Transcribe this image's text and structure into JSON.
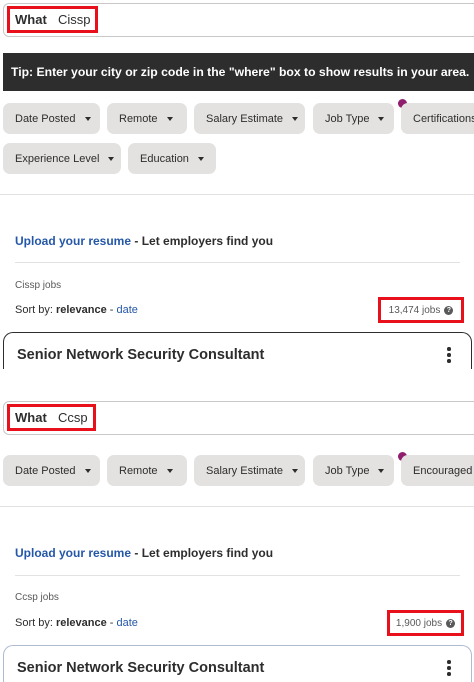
{
  "panel1": {
    "search": {
      "label": "What",
      "value": "Cissp"
    },
    "tip": "Tip: Enter your city or zip code in the \"where\" box to show results in your area.",
    "filters_row1": [
      "Date Posted",
      "Remote",
      "Salary Estimate",
      "Job Type",
      "Certifications"
    ],
    "filters_row2": [
      "Experience Level",
      "Education"
    ],
    "resume": {
      "link": "Upload your resume",
      "rest": " - Let employers find you"
    },
    "query_label": "Cissp jobs",
    "sort": {
      "prefix": "Sort by: ",
      "active": "relevance",
      "sep": " - ",
      "alt": "date"
    },
    "job_count": "13,474 jobs",
    "job_title": "Senior Network Security Consultant"
  },
  "panel2": {
    "search": {
      "label": "What",
      "value": "Ccsp"
    },
    "filters_row1": [
      "Date Posted",
      "Remote",
      "Salary Estimate",
      "Job Type",
      "Encouraged"
    ],
    "resume": {
      "link": "Upload your resume",
      "rest": " - Let employers find you"
    },
    "query_label": "Ccsp jobs",
    "sort": {
      "prefix": "Sort by: ",
      "active": "relevance",
      "sep": " - ",
      "alt": "date"
    },
    "job_count": "1,900 jobs",
    "job_title": "Senior Network Security Consultant"
  },
  "colors": {
    "highlight": "#e8101a",
    "link": "#2557a7",
    "tip_bg": "#2d2d2d",
    "pill_bg": "#e4e2e0",
    "dot": "#8f1e6c"
  }
}
